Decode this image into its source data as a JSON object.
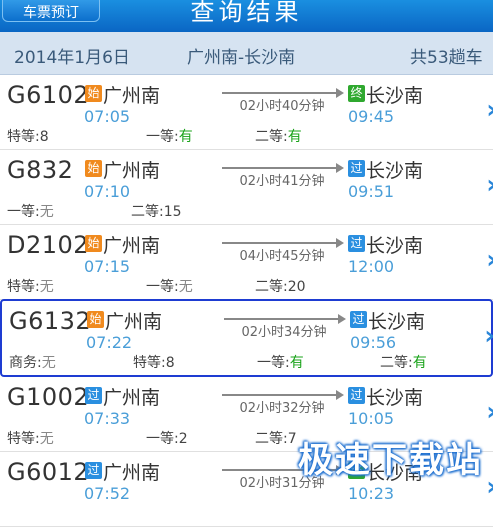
{
  "header": {
    "back_label": "车票预订",
    "title": "查询结果"
  },
  "summary": {
    "date": "2014年1月6日",
    "route": "广州南-长沙南",
    "count": "共53趟车"
  },
  "colors": {
    "start_badge": "#f08a1e",
    "pass_badge": "#2a8fe0",
    "end_badge": "#2fa82f",
    "available": "#1aa31a",
    "accent": "#1a7fd8"
  },
  "trains": [
    {
      "no": "G6102",
      "from_badge": "始",
      "from": "广州南",
      "dep": "07:05",
      "duration": "02小时40分钟",
      "to_badge": "终",
      "to": "长沙南",
      "arr": "09:45",
      "seats": [
        {
          "label": "特等:",
          "value": "8"
        },
        {
          "label": "一等:",
          "value": "有"
        },
        {
          "label": "二等:",
          "value": "有"
        }
      ]
    },
    {
      "no": "G832",
      "from_badge": "始",
      "from": "广州南",
      "dep": "07:10",
      "duration": "02小时41分钟",
      "to_badge": "过",
      "to": "长沙南",
      "arr": "09:51",
      "seats": [
        {
          "label": "一等:",
          "value": "无"
        },
        {
          "label": "二等:",
          "value": "15"
        }
      ]
    },
    {
      "no": "D2102",
      "from_badge": "始",
      "from": "广州南",
      "dep": "07:15",
      "duration": "04小时45分钟",
      "to_badge": "过",
      "to": "长沙南",
      "arr": "12:00",
      "seats": [
        {
          "label": "特等:",
          "value": "无"
        },
        {
          "label": "一等:",
          "value": "无"
        },
        {
          "label": "二等:",
          "value": "20"
        }
      ]
    },
    {
      "no": "G6132",
      "from_badge": "始",
      "from": "广州南",
      "dep": "07:22",
      "duration": "02小时34分钟",
      "to_badge": "过",
      "to": "长沙南",
      "arr": "09:56",
      "seats": [
        {
          "label": "商务:",
          "value": "无"
        },
        {
          "label": "特等:",
          "value": "8"
        },
        {
          "label": "一等:",
          "value": "有"
        },
        {
          "label": "二等:",
          "value": "有"
        }
      ]
    },
    {
      "no": "G1002",
      "from_badge": "过",
      "from": "广州南",
      "dep": "07:33",
      "duration": "02小时32分钟",
      "to_badge": "过",
      "to": "长沙南",
      "arr": "10:05",
      "seats": [
        {
          "label": "特等:",
          "value": "无"
        },
        {
          "label": "一等:",
          "value": "2"
        },
        {
          "label": "二等:",
          "value": "7"
        }
      ]
    },
    {
      "no": "G6012",
      "from_badge": "过",
      "from": "广州南",
      "dep": "07:52",
      "duration": "02小时31分钟",
      "to_badge": "终",
      "to": "长沙南",
      "arr": "10:23",
      "seats": []
    }
  ],
  "watermark": "极速下载站"
}
